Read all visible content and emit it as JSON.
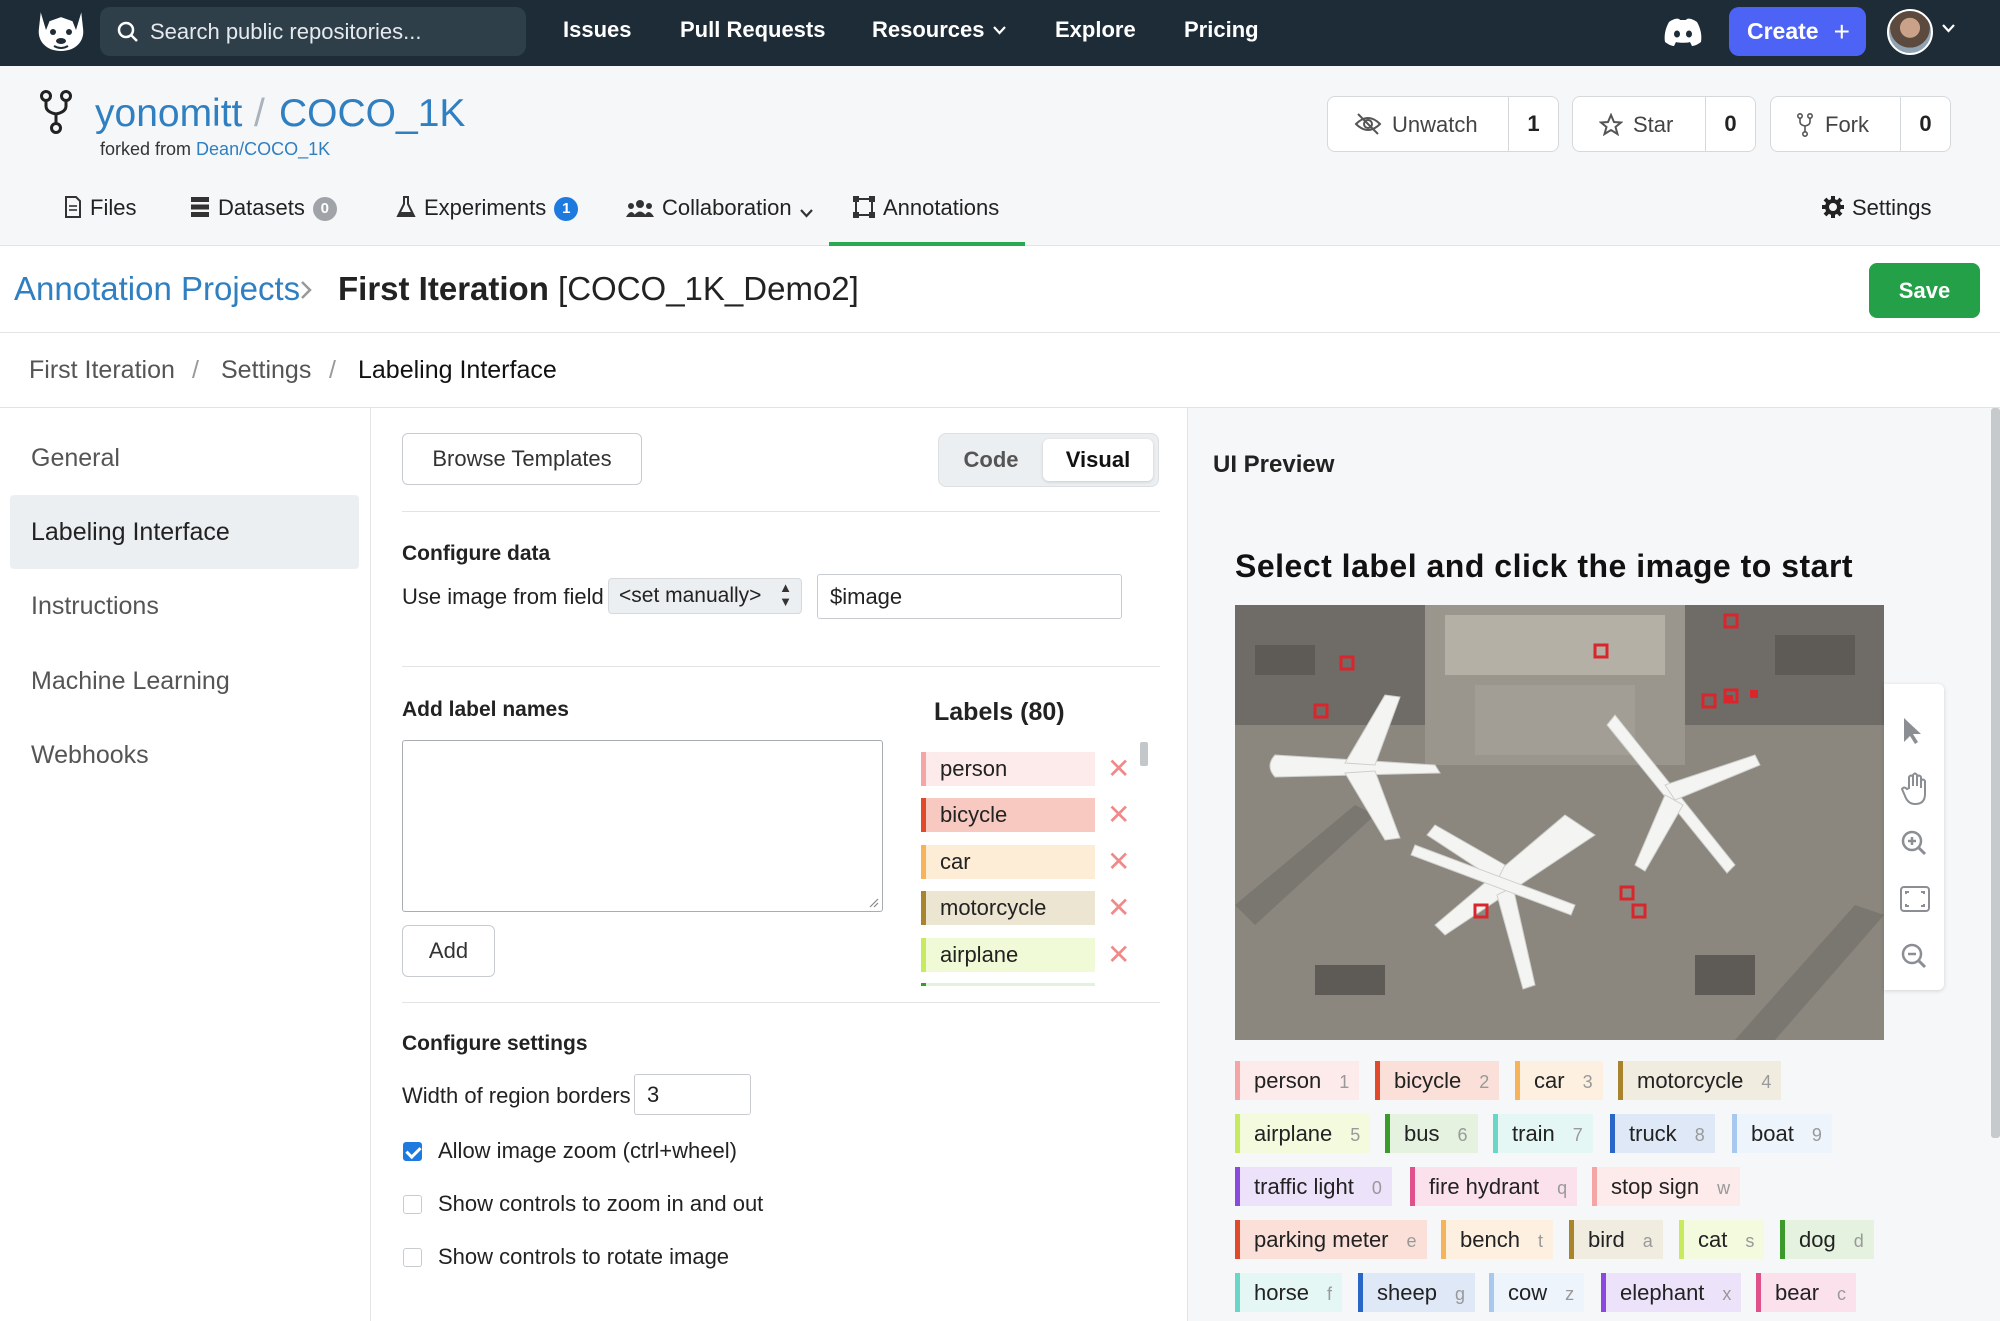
{
  "topbar": {
    "search_placeholder": "Search public repositories...",
    "nav": [
      "Issues",
      "Pull Requests",
      "Resources",
      "Explore",
      "Pricing"
    ],
    "create_label": "Create"
  },
  "repo": {
    "owner": "yonomitt",
    "separator": "/",
    "name": "COCO_1K",
    "forked_prefix": "forked from",
    "forked_link": "Dean/COCO_1K",
    "unwatch_label": "Unwatch",
    "unwatch_count": "1",
    "star_label": "Star",
    "star_count": "0",
    "fork_label": "Fork",
    "fork_count": "0"
  },
  "tabs": {
    "files": "Files",
    "datasets": "Datasets",
    "datasets_count": "0",
    "experiments": "Experiments",
    "experiments_count": "1",
    "collaboration": "Collaboration",
    "annotations": "Annotations",
    "settings": "Settings"
  },
  "title_bar": {
    "crumb": "Annotation Projects",
    "title_bold": "First Iteration",
    "title_rest": " [COCO_1K_Demo2]",
    "save_label": "Save"
  },
  "subcrumb": [
    "First Iteration",
    "/",
    "Settings",
    "/",
    "Labeling Interface"
  ],
  "sidebar": [
    "General",
    "Labeling Interface",
    "Instructions",
    "Machine Learning",
    "Webhooks"
  ],
  "config": {
    "browse_templates": "Browse Templates",
    "mode_code": "Code",
    "mode_visual": "Visual",
    "configure_data": "Configure data",
    "use_image_label": "Use image from field",
    "select_value": "<set manually>",
    "image_field_value": "$image",
    "add_label_names": "Add label names",
    "add_button": "Add",
    "labels_title": "Labels (80)",
    "labels": [
      {
        "name": "person",
        "color": "#f4a5a5"
      },
      {
        "name": "bicycle",
        "color": "#e04a2a"
      },
      {
        "name": "car",
        "color": "#f7b35a"
      },
      {
        "name": "motorcycle",
        "color": "#a8842c"
      },
      {
        "name": "airplane",
        "color": "#c8ea5e"
      }
    ],
    "configure_settings": "Configure settings",
    "border_width_label": "Width of region borders",
    "border_width_value": "3",
    "opt_zoom": "Allow image zoom (ctrl+wheel)",
    "opt_zoom_checked": true,
    "opt_zoom_controls": "Show controls to zoom in and out",
    "opt_rotate": "Show controls to rotate image"
  },
  "preview": {
    "title": "UI Preview",
    "heading": "Select label and click the image to start",
    "tags": [
      {
        "name": "person",
        "key": "1",
        "color": "#f4a5a5"
      },
      {
        "name": "bicycle",
        "key": "2",
        "color": "#e04a2a"
      },
      {
        "name": "car",
        "key": "3",
        "color": "#f7b35a"
      },
      {
        "name": "motorcycle",
        "key": "4",
        "color": "#a8842c"
      },
      {
        "name": "airplane",
        "key": "5",
        "color": "#c8ea5e"
      },
      {
        "name": "bus",
        "key": "6",
        "color": "#3a9a2a"
      },
      {
        "name": "train",
        "key": "7",
        "color": "#6ad6c6"
      },
      {
        "name": "truck",
        "key": "8",
        "color": "#2a66c8"
      },
      {
        "name": "boat",
        "key": "9",
        "color": "#a8c8f0"
      },
      {
        "name": "traffic light",
        "key": "0",
        "color": "#8a4ae0"
      },
      {
        "name": "fire hydrant",
        "key": "q",
        "color": "#e0508a"
      },
      {
        "name": "stop sign",
        "key": "w",
        "color": "#f4a5a5"
      },
      {
        "name": "parking meter",
        "key": "e",
        "color": "#e04a2a"
      },
      {
        "name": "bench",
        "key": "t",
        "color": "#f7b35a"
      },
      {
        "name": "bird",
        "key": "a",
        "color": "#a8842c"
      },
      {
        "name": "cat",
        "key": "s",
        "color": "#c8ea5e"
      },
      {
        "name": "dog",
        "key": "d",
        "color": "#3a9a2a"
      },
      {
        "name": "horse",
        "key": "f",
        "color": "#6ad6c6"
      },
      {
        "name": "sheep",
        "key": "g",
        "color": "#2a66c8"
      },
      {
        "name": "cow",
        "key": "z",
        "color": "#a8c8f0"
      },
      {
        "name": "elephant",
        "key": "x",
        "color": "#8a4ae0"
      },
      {
        "name": "bear",
        "key": "c",
        "color": "#e0508a"
      }
    ]
  }
}
